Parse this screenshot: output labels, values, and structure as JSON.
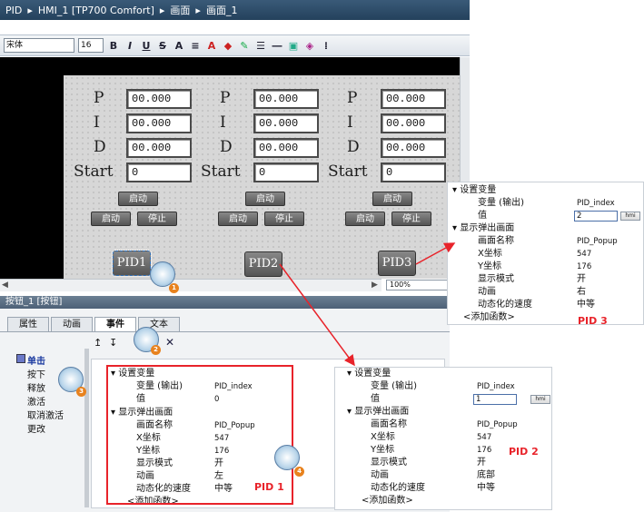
{
  "breadcrumb": [
    "PID",
    "HMI_1 [TP700 Comfort]",
    "画面",
    "画面_1"
  ],
  "toolbar": {
    "font_name": "宋体",
    "font_size": "16",
    "format_buttons": [
      "B",
      "I",
      "U",
      "S",
      "A",
      "≡"
    ]
  },
  "canvas": {
    "pid_columns": [
      {
        "fields": [
          {
            "label": "P",
            "value": "00.000"
          },
          {
            "label": "I",
            "value": "00.000"
          },
          {
            "label": "D",
            "value": "00.000"
          },
          {
            "label": "Start",
            "value": "0"
          }
        ],
        "start_btn1": "启动",
        "start_btn2": "启动",
        "stop_btn": "停止",
        "pid_button": "PID1"
      },
      {
        "fields": [
          {
            "label": "P",
            "value": "00.000"
          },
          {
            "label": "I",
            "value": "00.000"
          },
          {
            "label": "D",
            "value": "00.000"
          },
          {
            "label": "Start",
            "value": "0"
          }
        ],
        "start_btn1": "启动",
        "start_btn2": "启动",
        "stop_btn": "停止",
        "pid_button": "PID2"
      },
      {
        "fields": [
          {
            "label": "P",
            "value": "00.000"
          },
          {
            "label": "I",
            "value": "00.000"
          },
          {
            "label": "D",
            "value": "00.000"
          },
          {
            "label": "Start",
            "value": "0"
          }
        ],
        "start_btn1": "启动",
        "start_btn2": "启动",
        "stop_btn": "停止",
        "pid_button": "PID3"
      }
    ],
    "zoom": "100%"
  },
  "inspector": {
    "title": "按钮_1 [按钮]",
    "tabs": [
      "属性",
      "动画",
      "事件",
      "文本"
    ],
    "active_tab": "事件",
    "events": [
      "单击",
      "按下",
      "释放",
      "激活",
      "取消激活",
      "更改"
    ]
  },
  "popup_labels": {
    "set_var": "设置变量",
    "var_output": "变量 (输出)",
    "value": "值",
    "show_popup": "显示弹出画面",
    "screen_name": "画面名称",
    "x_coord": "X坐标",
    "y_coord": "Y坐标",
    "display_mode": "显示模式",
    "animation": "动画",
    "anim_speed": "动态化的速度",
    "add_func": "<添加函数>"
  },
  "pid1": {
    "var": "PID_index",
    "value": "0",
    "screen": "PID_Popup",
    "x": "547",
    "y": "176",
    "mode": "开",
    "anim": "左",
    "speed": "中等",
    "label": "PID 1"
  },
  "pid2": {
    "var": "PID_index",
    "value": "1",
    "screen": "PID_Popup",
    "x": "547",
    "y": "176",
    "mode": "开",
    "anim": "底部",
    "speed": "中等",
    "label": "PID 2"
  },
  "pid3": {
    "var": "PID_index",
    "value": "2",
    "screen": "PID_Popup",
    "x": "547",
    "y": "176",
    "mode": "开",
    "anim": "右",
    "speed": "中等",
    "label": "PID 3"
  },
  "hmi_badge": "hmi",
  "callouts": [
    "1",
    "2",
    "3",
    "4"
  ]
}
